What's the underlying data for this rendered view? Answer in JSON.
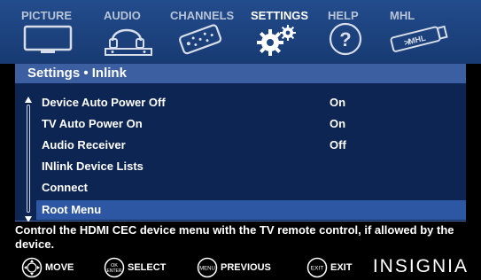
{
  "tabs": [
    {
      "label": "PICTURE",
      "icon": "tv-icon",
      "active": false
    },
    {
      "label": "AUDIO",
      "icon": "headphones-icon",
      "active": false
    },
    {
      "label": "CHANNELS",
      "icon": "remote-icon",
      "active": false
    },
    {
      "label": "SETTINGS",
      "icon": "gears-icon",
      "active": true
    },
    {
      "label": "HELP",
      "icon": "help-icon",
      "active": false
    },
    {
      "label": "MHL",
      "icon": "mhl-cable-icon",
      "active": false
    }
  ],
  "panel": {
    "title": "Settings  • Inlink",
    "items": [
      {
        "label": "Device Auto Power Off",
        "value": "On"
      },
      {
        "label": "TV Auto Power On",
        "value": "On"
      },
      {
        "label": "Audio Receiver",
        "value": "Off"
      },
      {
        "label": "INlink Device Lists",
        "value": ""
      },
      {
        "label": "Connect",
        "value": ""
      },
      {
        "label": "Root Menu",
        "value": "",
        "selected": true
      }
    ]
  },
  "help_text": "Control the HDMI CEC device menu with the TV remote control, if allowed by the device.",
  "footer": {
    "hints": [
      {
        "icon_text": "",
        "label": "MOVE"
      },
      {
        "icon_text": "OK ENTER",
        "label": "SELECT"
      },
      {
        "icon_text": "MENU",
        "label": "PREVIOUS"
      },
      {
        "icon_text": "EXIT",
        "label": "EXIT"
      }
    ],
    "brand": "INSIGNIA"
  },
  "colors": {
    "tab_bar": "#1d4580",
    "panel_bg": "#0d2553",
    "panel_header": "#3b5fa0",
    "selected_row": "#2d57a3"
  }
}
